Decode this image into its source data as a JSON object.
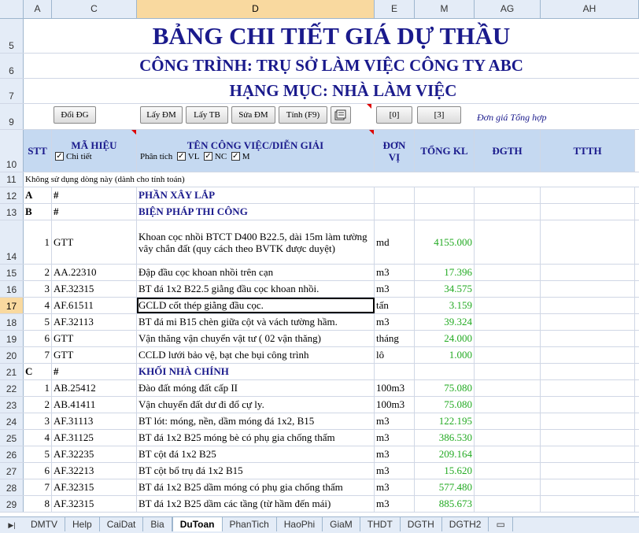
{
  "columns": [
    "A",
    "C",
    "D",
    "E",
    "M",
    "AG",
    "AH"
  ],
  "selected_column": "D",
  "title": "BẢNG CHI TIẾT GIÁ DỰ THẦU",
  "project": "CÔNG TRÌNH: TRỤ SỞ LÀM VIỆC CÔNG TY ABC",
  "category": "HẠNG MỤC: NHÀ LÀM VIỆC",
  "buttons": {
    "doi_dg": "Đổi ĐG",
    "lay_dm": "Lấy ĐM",
    "lay_tb": "Lấy TB",
    "sua_dm": "Sửa ĐM",
    "tinh": "Tính (F9)",
    "b0": "[0]",
    "b3": "[3]"
  },
  "note_dongia": "Đơn giá Tổng hợp",
  "header": {
    "stt": "STT",
    "ma_hieu": "MÃ HIỆU",
    "chi_tiet": "Chi tiết",
    "ten": "TÊN CÔNG VIỆC/DIỄN GIẢI",
    "phan_tich": "Phân tích",
    "vl": "VL",
    "nc": "NC",
    "m": "M",
    "don_vi": "ĐƠN VỊ",
    "tong_kl": "TỔNG KL",
    "dgth": "ĐGTH",
    "ttth": "TTTH"
  },
  "row_numbers": {
    "r5": "5",
    "r6": "6",
    "r7": "7",
    "r9": "9",
    "r10": "10"
  },
  "note_row": {
    "num": "11",
    "text": "Không sử dụng dòng này (dành cho tính toán)"
  },
  "rows": [
    {
      "num": "12",
      "a": "A",
      "c": "#",
      "d": "PHẦN XÂY LẮP",
      "e": "",
      "m": "",
      "type": "section"
    },
    {
      "num": "13",
      "a": "B",
      "c": "#",
      "d": "BIỆN PHÁP THI CÔNG",
      "e": "",
      "m": "",
      "type": "section"
    },
    {
      "num": "14",
      "a": "1",
      "c": "GTT",
      "d": "Khoan cọc nhồi BTCT D400 B22.5, dài 15m làm tường vây chắn đất (quy cách theo BVTK được duyệt)",
      "e": "md",
      "m": "4155.000",
      "type": "tall"
    },
    {
      "num": "15",
      "a": "2",
      "c": "AA.22310",
      "d": "Đập đầu cọc khoan nhồi trên cạn",
      "e": "m3",
      "m": "17.396",
      "type": "item"
    },
    {
      "num": "16",
      "a": "3",
      "c": "AF.32315",
      "d": "BT đá 1x2 B22.5 giằng đầu cọc khoan nhồi.",
      "e": "m3",
      "m": "34.575",
      "type": "item"
    },
    {
      "num": "17",
      "a": "4",
      "c": "AF.61511",
      "d": "GCLD cốt thép giằng đầu cọc.",
      "e": "tấn",
      "m": "3.159",
      "type": "item",
      "active": true
    },
    {
      "num": "18",
      "a": "5",
      "c": "AF.32113",
      "d": "BT đá mi B15 chèn giữa cột và vách tường hầm.",
      "e": "m3",
      "m": "39.324",
      "type": "item"
    },
    {
      "num": "19",
      "a": "6",
      "c": "GTT",
      "d": "Vận thăng vận chuyển vật tư ( 02 vận thăng)",
      "e": "tháng",
      "m": "24.000",
      "type": "item"
    },
    {
      "num": "20",
      "a": "7",
      "c": "GTT",
      "d": "CCLD lưới bảo vệ, bạt che bụi công trình",
      "e": "lô",
      "m": "1.000",
      "type": "item"
    },
    {
      "num": "21",
      "a": "C",
      "c": "#",
      "d": "KHỐI NHÀ CHÍNH",
      "e": "",
      "m": "",
      "type": "section"
    },
    {
      "num": "22",
      "a": "1",
      "c": "AB.25412",
      "d": "Đào đất móng đất cấp II",
      "e": "100m3",
      "m": "75.080",
      "type": "item"
    },
    {
      "num": "23",
      "a": "2",
      "c": "AB.41411",
      "d": "Vận chuyển đất dư đi đổ cự ly.",
      "e": "100m3",
      "m": "75.080",
      "type": "item"
    },
    {
      "num": "24",
      "a": "3",
      "c": "AF.31113",
      "d": "BT lót: móng, nền, dầm móng đá 1x2, B15",
      "e": "m3",
      "m": "122.195",
      "type": "item"
    },
    {
      "num": "25",
      "a": "4",
      "c": "AF.31125",
      "d": "BT đá 1x2 B25 móng bè có phụ gia chống thấm",
      "e": "m3",
      "m": "386.530",
      "type": "item"
    },
    {
      "num": "26",
      "a": "5",
      "c": "AF.32235",
      "d": "BT cột đá 1x2 B25",
      "e": "m3",
      "m": "209.164",
      "type": "item"
    },
    {
      "num": "27",
      "a": "6",
      "c": "AF.32213",
      "d": "BT  cột bổ trụ đá 1x2 B15",
      "e": "m3",
      "m": "15.620",
      "type": "item"
    },
    {
      "num": "28",
      "a": "7",
      "c": "AF.32315",
      "d": "BT đá 1x2 B25 dầm móng có phụ gia chống thấm",
      "e": "m3",
      "m": "577.480",
      "type": "item"
    },
    {
      "num": "29",
      "a": "8",
      "c": "AF.32315",
      "d": "BT đá 1x2 B25 dầm các tầng (từ hầm đến mái)",
      "e": "m3",
      "m": "885.673",
      "type": "item"
    }
  ],
  "tabs": [
    "DMTV",
    "Help",
    "CaiDat",
    "Bia",
    "DuToan",
    "PhanTich",
    "HaoPhi",
    "GiaM",
    "THDT",
    "DGTH",
    "DGTH2"
  ],
  "active_tab": "DuToan",
  "colors": {
    "title": "#1a1a8c",
    "header_bg": "#c5d9f1",
    "value": "#22aa22",
    "selected_header": "#f9d99f"
  }
}
